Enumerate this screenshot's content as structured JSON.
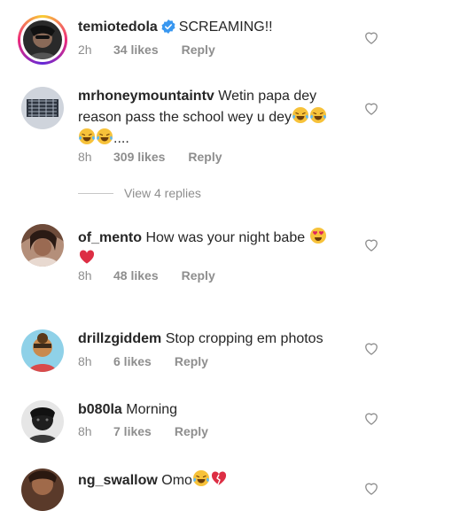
{
  "comments": [
    {
      "username": "temiotedola",
      "verified": true,
      "text": "SCREAMING!!",
      "time": "2h",
      "likes": "34 likes",
      "reply": "Reply"
    },
    {
      "username": "mrhoneymountaintv",
      "verified": false,
      "text_line1": "Wetin papa dey",
      "text_line2": "reason pass the school wey u dey",
      "text_line3": "....",
      "time": "8h",
      "likes": "309 likes",
      "reply": "Reply"
    },
    {
      "username": "of_mento",
      "verified": false,
      "text": "How was your night babe",
      "time": "8h",
      "likes": "48 likes",
      "reply": "Reply"
    },
    {
      "username": "drillzgiddem",
      "verified": false,
      "text": "Stop cropping em photos",
      "time": "8h",
      "likes": "6 likes",
      "reply": "Reply"
    },
    {
      "username": "b080la",
      "verified": false,
      "text": "Morning",
      "time": "8h",
      "likes": "7 likes",
      "reply": "Reply"
    },
    {
      "username": "ng_swallow",
      "verified": false,
      "text": "Omo",
      "time": "",
      "likes": "",
      "reply": ""
    }
  ],
  "view_replies": "View 4 replies",
  "icons": {
    "like": "heart-outline-icon",
    "verified": "verified-badge-icon",
    "laughing": "face-with-tears-of-joy-emoji",
    "heart_eyes": "smiling-face-heart-eyes-emoji",
    "red_heart": "red-heart-emoji",
    "broken_heart": "broken-heart-emoji"
  },
  "colors": {
    "text": "#262626",
    "muted": "#8e8e8e",
    "verified": "#3897f0",
    "heart_outline": "#8e8e8e"
  }
}
